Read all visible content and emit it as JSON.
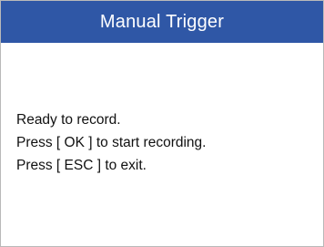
{
  "header": {
    "title": "Manual Trigger"
  },
  "message": {
    "lines": [
      "Ready to record.",
      "Press [ OK ] to start recording.",
      "Press [ ESC ] to exit."
    ]
  },
  "colors": {
    "title_bar": "#2f57a6",
    "title_text": "#ffffff",
    "body_background": "#ffffff",
    "body_text": "#111111"
  }
}
